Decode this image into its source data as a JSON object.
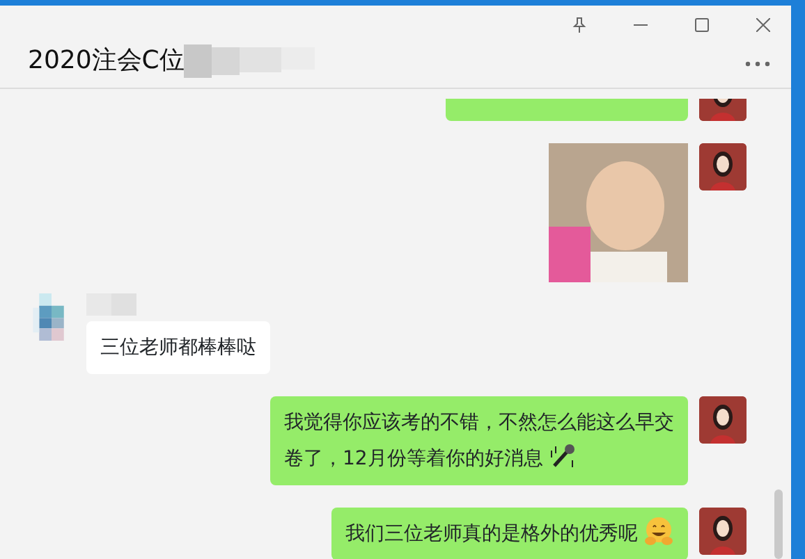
{
  "window": {
    "title": "2020注会C位"
  },
  "messages": [
    {
      "kind": "sent",
      "parts": [
        {
          "kind": "clipped"
        }
      ]
    },
    {
      "kind": "sent",
      "parts": [
        {
          "kind": "photo"
        }
      ]
    },
    {
      "kind": "received",
      "parts": [
        {
          "kind": "text",
          "text": "三位老师都棒棒哒"
        }
      ]
    },
    {
      "kind": "sent",
      "parts": [
        {
          "kind": "text",
          "text": "我觉得你应该考的不错，不然怎么能这么早交卷了，12月份等着你的好消息"
        },
        {
          "kind": "microphone"
        }
      ]
    },
    {
      "kind": "sent",
      "parts": [
        {
          "kind": "text",
          "text": "我们三位老师真的是格外的优秀呢"
        },
        {
          "kind": "hugging"
        }
      ]
    }
  ]
}
